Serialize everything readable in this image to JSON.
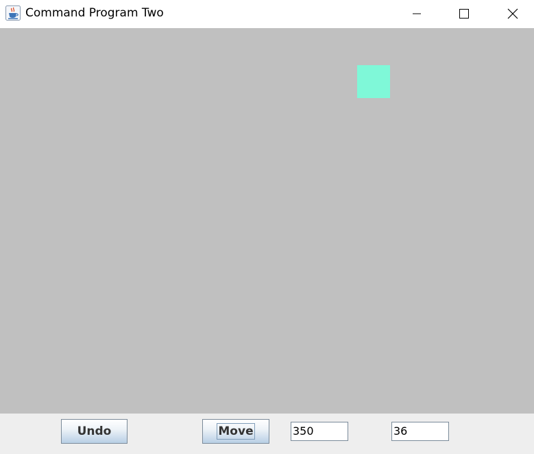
{
  "window": {
    "title": "Command Program Two",
    "icon": "java-cup-icon",
    "controls": [
      "minimize-icon",
      "maximize-icon",
      "close-icon"
    ]
  },
  "canvas": {
    "background": "#c0c0c0",
    "shape_color": "#7ff8d8"
  },
  "controls": {
    "undo_label": "Undo",
    "move_label": "Move",
    "x_value": "350",
    "y_value": "36"
  },
  "colors": {
    "panel": "#eeeeee",
    "titlebar": "#ffffff"
  }
}
